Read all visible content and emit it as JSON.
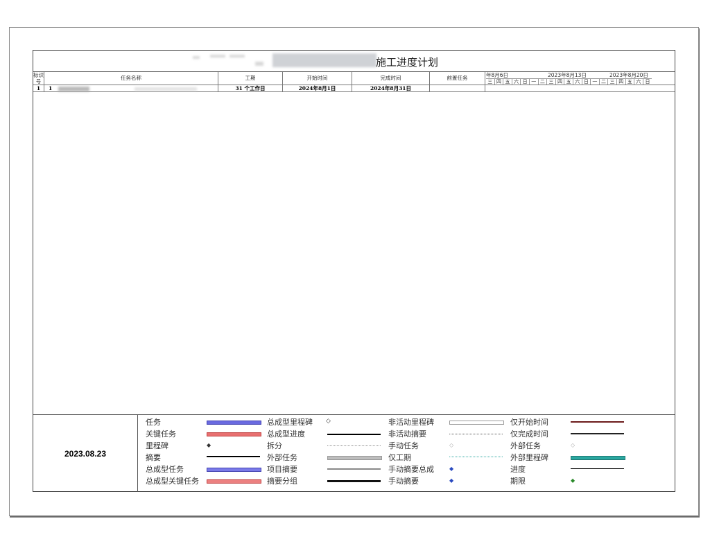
{
  "project": {
    "title": "施工进度计划",
    "date": "2023.08.23"
  },
  "columns": {
    "id": "标识号",
    "name": "任务名称",
    "duration": "工期",
    "start": "开始时间",
    "finish": "完成时间",
    "predecessors": "前置任务"
  },
  "timeline": {
    "weeks": [
      "年8月6日",
      "2023年8月13日",
      "2023年8月20日"
    ],
    "week1_days": [
      "三",
      "四",
      "五",
      "六"
    ],
    "week2_days": [
      "日",
      "一",
      "二",
      "三",
      "四",
      "五",
      "六"
    ],
    "week3_days": [
      "日",
      "一",
      "二",
      "三",
      "四",
      "五",
      "六"
    ],
    "tail_day": "日"
  },
  "tasks": [
    {
      "id": "1",
      "outline": "1",
      "duration": "31 个工作日",
      "start": "2024年8月1日",
      "finish": "2024年8月31日",
      "predecessors": ""
    }
  ],
  "legend": [
    [
      "任务",
      "总成型里程碑",
      "非活动里程碑",
      "仅开始时间"
    ],
    [
      "关键任务",
      "总成型进度",
      "非活动摘要",
      "仅完成时间"
    ],
    [
      "里程碑",
      "拆分",
      "手动任务",
      "外部任务"
    ],
    [
      "摘要",
      "外部任务",
      "仅工期",
      "外部里程碑"
    ],
    [
      "总成型任务",
      "项目摘要",
      "手动摘要总成",
      "进度"
    ],
    [
      "总成型关键任务",
      "摘要分组",
      "手动摘要",
      "期限"
    ]
  ],
  "colors": {
    "task": "#5b5bdc",
    "critical": "#e05a5a",
    "summary": "#000000",
    "external": "#9e9e9e",
    "start_only": "#6b1a1a",
    "external_milestone": "#2aa7a0",
    "deadline": "#2a8a2a"
  }
}
